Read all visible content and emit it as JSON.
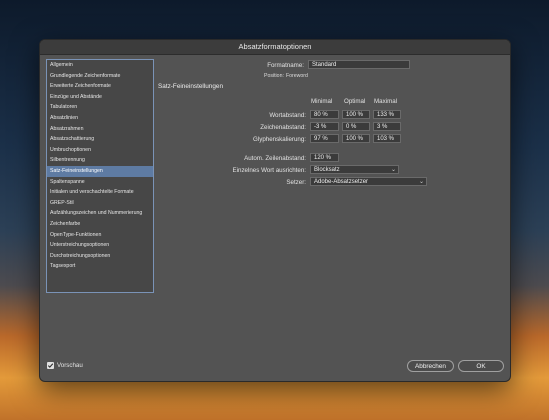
{
  "dialog": {
    "title": "Absatzformatoptionen"
  },
  "sidebar": {
    "items": [
      {
        "label": "Allgemein"
      },
      {
        "label": "Grundlegende Zeichenformate"
      },
      {
        "label": "Erweiterte Zeichenformate"
      },
      {
        "label": "Einzüge und Abstände"
      },
      {
        "label": "Tabulatoren"
      },
      {
        "label": "Absatzlinien"
      },
      {
        "label": "Absatzrahmen"
      },
      {
        "label": "Absatzschattierung"
      },
      {
        "label": "Umbruchoptionen"
      },
      {
        "label": "Silbentrennung"
      },
      {
        "label": "Satz-Feineinstellungen"
      },
      {
        "label": "Spaltenspanne"
      },
      {
        "label": "Initialen und verschachtelte Formate"
      },
      {
        "label": "GREP-Stil"
      },
      {
        "label": "Aufzählungszeichen und Nummerierung"
      },
      {
        "label": "Zeichenfarbe"
      },
      {
        "label": "OpenType-Funktionen"
      },
      {
        "label": "Unterstreichungsoptionen"
      },
      {
        "label": "Durchstreichungsoptionen"
      },
      {
        "label": "Tagsexport"
      }
    ],
    "selected": "Satz-Feineinstellungen"
  },
  "main": {
    "formatname_label": "Formatname:",
    "formatname_value": "Standard",
    "position_label": "Position:",
    "position_value": "Foreword",
    "section_title": "Satz-Feineinstellungen",
    "columns": {
      "min": "Minimal",
      "opt": "Optimal",
      "max": "Maximal"
    },
    "rows": [
      {
        "label": "Wortabstand:",
        "min": "80 %",
        "opt": "100 %",
        "max": "133 %"
      },
      {
        "label": "Zeichenabstand:",
        "min": "-3 %",
        "opt": "0 %",
        "max": "3 %"
      },
      {
        "label": "Glyphenskalierung:",
        "min": "97 %",
        "opt": "100 %",
        "max": "103 %"
      }
    ],
    "leading_label": "Autom. Zeilenabstand:",
    "leading_value": "120 %",
    "single_word_label": "Einzelnes Wort ausrichten:",
    "single_word_value": "Blocksatz",
    "composer_label": "Setzer:",
    "composer_value": "Adobe-Absatzsetzer"
  },
  "footer": {
    "preview_label": "Vorschau",
    "preview_checked": true,
    "cancel_label": "Abbrechen",
    "ok_label": "OK"
  }
}
